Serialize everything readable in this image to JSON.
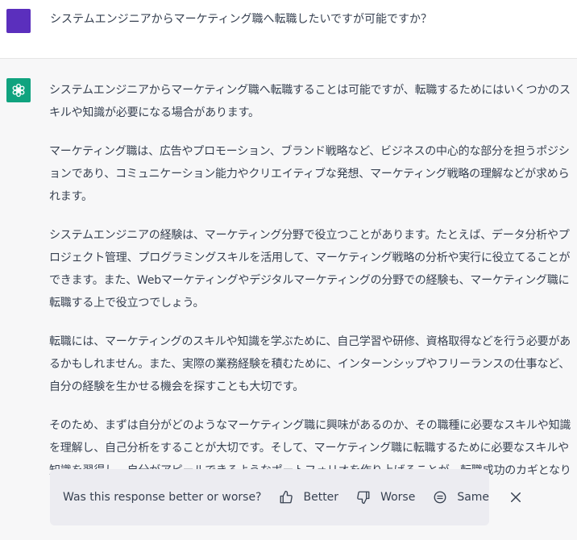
{
  "user": {
    "message": "システムエンジニアからマーケティング職へ転職したいですが可能ですか？"
  },
  "assistant": {
    "paragraphs": [
      "システムエンジニアからマーケティング職へ転職することは可能ですが、転職するためにはいくつかのスキルや知識が必要になる場合があります。",
      "マーケティング職は、広告やプロモーション、ブランド戦略など、ビジネスの中心的な部分を担うポジションであり、コミュニケーション能力やクリエイティブな発想、マーケティング戦略の理解などが求められます。",
      "システムエンジニアの経験は、マーケティング分野で役立つことがあります。たとえば、データ分析やプロジェクト管理、プログラミングスキルを活用して、マーケティング戦略の分析や実行に役立てることができます。また、Webマーケティングやデジタルマーケティングの分野での経験も、マーケティング職に転職する上で役立つでしょう。",
      "転職には、マーケティングのスキルや知識を学ぶために、自己学習や研修、資格取得などを行う必要があるかもしれません。また、実際の業務経験を積むために、インターンシップやフリーランスの仕事など、自分の経験を生かせる機会を探すことも大切です。",
      "そのため、まずは自分がどのようなマーケティング職に興味があるのか、その職種に必要なスキルや知識を理解し、自己分析をすることが大切です。そして、マーケティング職に転職するために必要なスキルや知識を習得し、自分がアピールできるようなポートフォリオを作り上げることが、転職成功のカギとなります。"
    ]
  },
  "feedback": {
    "question": "Was this response better or worse?",
    "better_label": "Better",
    "worse_label": "Worse",
    "same_label": "Same"
  },
  "icons": {
    "user_avatar": "user-avatar",
    "bot_avatar": "openai-logo-icon",
    "better": "thumbs-up-icon",
    "worse": "thumbs-down-icon",
    "same": "equals-circle-icon",
    "close": "close-icon"
  },
  "colors": {
    "user_avatar": "#5b2fbd",
    "bot_avatar": "#10a37f",
    "text": "#374151",
    "assistant_background": "#f7f7f8",
    "feedback_background": "#ececf1"
  }
}
